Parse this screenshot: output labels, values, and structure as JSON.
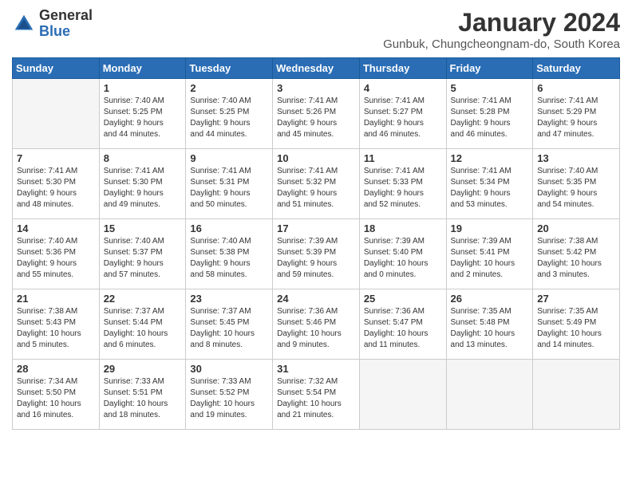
{
  "logo": {
    "general": "General",
    "blue": "Blue"
  },
  "title": "January 2024",
  "location": "Gunbuk, Chungcheongnam-do, South Korea",
  "days": [
    "Sunday",
    "Monday",
    "Tuesday",
    "Wednesday",
    "Thursday",
    "Friday",
    "Saturday"
  ],
  "weeks": [
    [
      {
        "day": "",
        "sunrise": "",
        "sunset": "",
        "daylight": ""
      },
      {
        "day": "1",
        "sunrise": "Sunrise: 7:40 AM",
        "sunset": "Sunset: 5:25 PM",
        "daylight": "Daylight: 9 hours and 44 minutes."
      },
      {
        "day": "2",
        "sunrise": "Sunrise: 7:40 AM",
        "sunset": "Sunset: 5:25 PM",
        "daylight": "Daylight: 9 hours and 44 minutes."
      },
      {
        "day": "3",
        "sunrise": "Sunrise: 7:41 AM",
        "sunset": "Sunset: 5:26 PM",
        "daylight": "Daylight: 9 hours and 45 minutes."
      },
      {
        "day": "4",
        "sunrise": "Sunrise: 7:41 AM",
        "sunset": "Sunset: 5:27 PM",
        "daylight": "Daylight: 9 hours and 46 minutes."
      },
      {
        "day": "5",
        "sunrise": "Sunrise: 7:41 AM",
        "sunset": "Sunset: 5:28 PM",
        "daylight": "Daylight: 9 hours and 46 minutes."
      },
      {
        "day": "6",
        "sunrise": "Sunrise: 7:41 AM",
        "sunset": "Sunset: 5:29 PM",
        "daylight": "Daylight: 9 hours and 47 minutes."
      }
    ],
    [
      {
        "day": "7",
        "sunrise": "Sunrise: 7:41 AM",
        "sunset": "Sunset: 5:30 PM",
        "daylight": "Daylight: 9 hours and 48 minutes."
      },
      {
        "day": "8",
        "sunrise": "Sunrise: 7:41 AM",
        "sunset": "Sunset: 5:30 PM",
        "daylight": "Daylight: 9 hours and 49 minutes."
      },
      {
        "day": "9",
        "sunrise": "Sunrise: 7:41 AM",
        "sunset": "Sunset: 5:31 PM",
        "daylight": "Daylight: 9 hours and 50 minutes."
      },
      {
        "day": "10",
        "sunrise": "Sunrise: 7:41 AM",
        "sunset": "Sunset: 5:32 PM",
        "daylight": "Daylight: 9 hours and 51 minutes."
      },
      {
        "day": "11",
        "sunrise": "Sunrise: 7:41 AM",
        "sunset": "Sunset: 5:33 PM",
        "daylight": "Daylight: 9 hours and 52 minutes."
      },
      {
        "day": "12",
        "sunrise": "Sunrise: 7:41 AM",
        "sunset": "Sunset: 5:34 PM",
        "daylight": "Daylight: 9 hours and 53 minutes."
      },
      {
        "day": "13",
        "sunrise": "Sunrise: 7:40 AM",
        "sunset": "Sunset: 5:35 PM",
        "daylight": "Daylight: 9 hours and 54 minutes."
      }
    ],
    [
      {
        "day": "14",
        "sunrise": "Sunrise: 7:40 AM",
        "sunset": "Sunset: 5:36 PM",
        "daylight": "Daylight: 9 hours and 55 minutes."
      },
      {
        "day": "15",
        "sunrise": "Sunrise: 7:40 AM",
        "sunset": "Sunset: 5:37 PM",
        "daylight": "Daylight: 9 hours and 57 minutes."
      },
      {
        "day": "16",
        "sunrise": "Sunrise: 7:40 AM",
        "sunset": "Sunset: 5:38 PM",
        "daylight": "Daylight: 9 hours and 58 minutes."
      },
      {
        "day": "17",
        "sunrise": "Sunrise: 7:39 AM",
        "sunset": "Sunset: 5:39 PM",
        "daylight": "Daylight: 9 hours and 59 minutes."
      },
      {
        "day": "18",
        "sunrise": "Sunrise: 7:39 AM",
        "sunset": "Sunset: 5:40 PM",
        "daylight": "Daylight: 10 hours and 0 minutes."
      },
      {
        "day": "19",
        "sunrise": "Sunrise: 7:39 AM",
        "sunset": "Sunset: 5:41 PM",
        "daylight": "Daylight: 10 hours and 2 minutes."
      },
      {
        "day": "20",
        "sunrise": "Sunrise: 7:38 AM",
        "sunset": "Sunset: 5:42 PM",
        "daylight": "Daylight: 10 hours and 3 minutes."
      }
    ],
    [
      {
        "day": "21",
        "sunrise": "Sunrise: 7:38 AM",
        "sunset": "Sunset: 5:43 PM",
        "daylight": "Daylight: 10 hours and 5 minutes."
      },
      {
        "day": "22",
        "sunrise": "Sunrise: 7:37 AM",
        "sunset": "Sunset: 5:44 PM",
        "daylight": "Daylight: 10 hours and 6 minutes."
      },
      {
        "day": "23",
        "sunrise": "Sunrise: 7:37 AM",
        "sunset": "Sunset: 5:45 PM",
        "daylight": "Daylight: 10 hours and 8 minutes."
      },
      {
        "day": "24",
        "sunrise": "Sunrise: 7:36 AM",
        "sunset": "Sunset: 5:46 PM",
        "daylight": "Daylight: 10 hours and 9 minutes."
      },
      {
        "day": "25",
        "sunrise": "Sunrise: 7:36 AM",
        "sunset": "Sunset: 5:47 PM",
        "daylight": "Daylight: 10 hours and 11 minutes."
      },
      {
        "day": "26",
        "sunrise": "Sunrise: 7:35 AM",
        "sunset": "Sunset: 5:48 PM",
        "daylight": "Daylight: 10 hours and 13 minutes."
      },
      {
        "day": "27",
        "sunrise": "Sunrise: 7:35 AM",
        "sunset": "Sunset: 5:49 PM",
        "daylight": "Daylight: 10 hours and 14 minutes."
      }
    ],
    [
      {
        "day": "28",
        "sunrise": "Sunrise: 7:34 AM",
        "sunset": "Sunset: 5:50 PM",
        "daylight": "Daylight: 10 hours and 16 minutes."
      },
      {
        "day": "29",
        "sunrise": "Sunrise: 7:33 AM",
        "sunset": "Sunset: 5:51 PM",
        "daylight": "Daylight: 10 hours and 18 minutes."
      },
      {
        "day": "30",
        "sunrise": "Sunrise: 7:33 AM",
        "sunset": "Sunset: 5:52 PM",
        "daylight": "Daylight: 10 hours and 19 minutes."
      },
      {
        "day": "31",
        "sunrise": "Sunrise: 7:32 AM",
        "sunset": "Sunset: 5:54 PM",
        "daylight": "Daylight: 10 hours and 21 minutes."
      },
      {
        "day": "",
        "sunrise": "",
        "sunset": "",
        "daylight": ""
      },
      {
        "day": "",
        "sunrise": "",
        "sunset": "",
        "daylight": ""
      },
      {
        "day": "",
        "sunrise": "",
        "sunset": "",
        "daylight": ""
      }
    ]
  ]
}
